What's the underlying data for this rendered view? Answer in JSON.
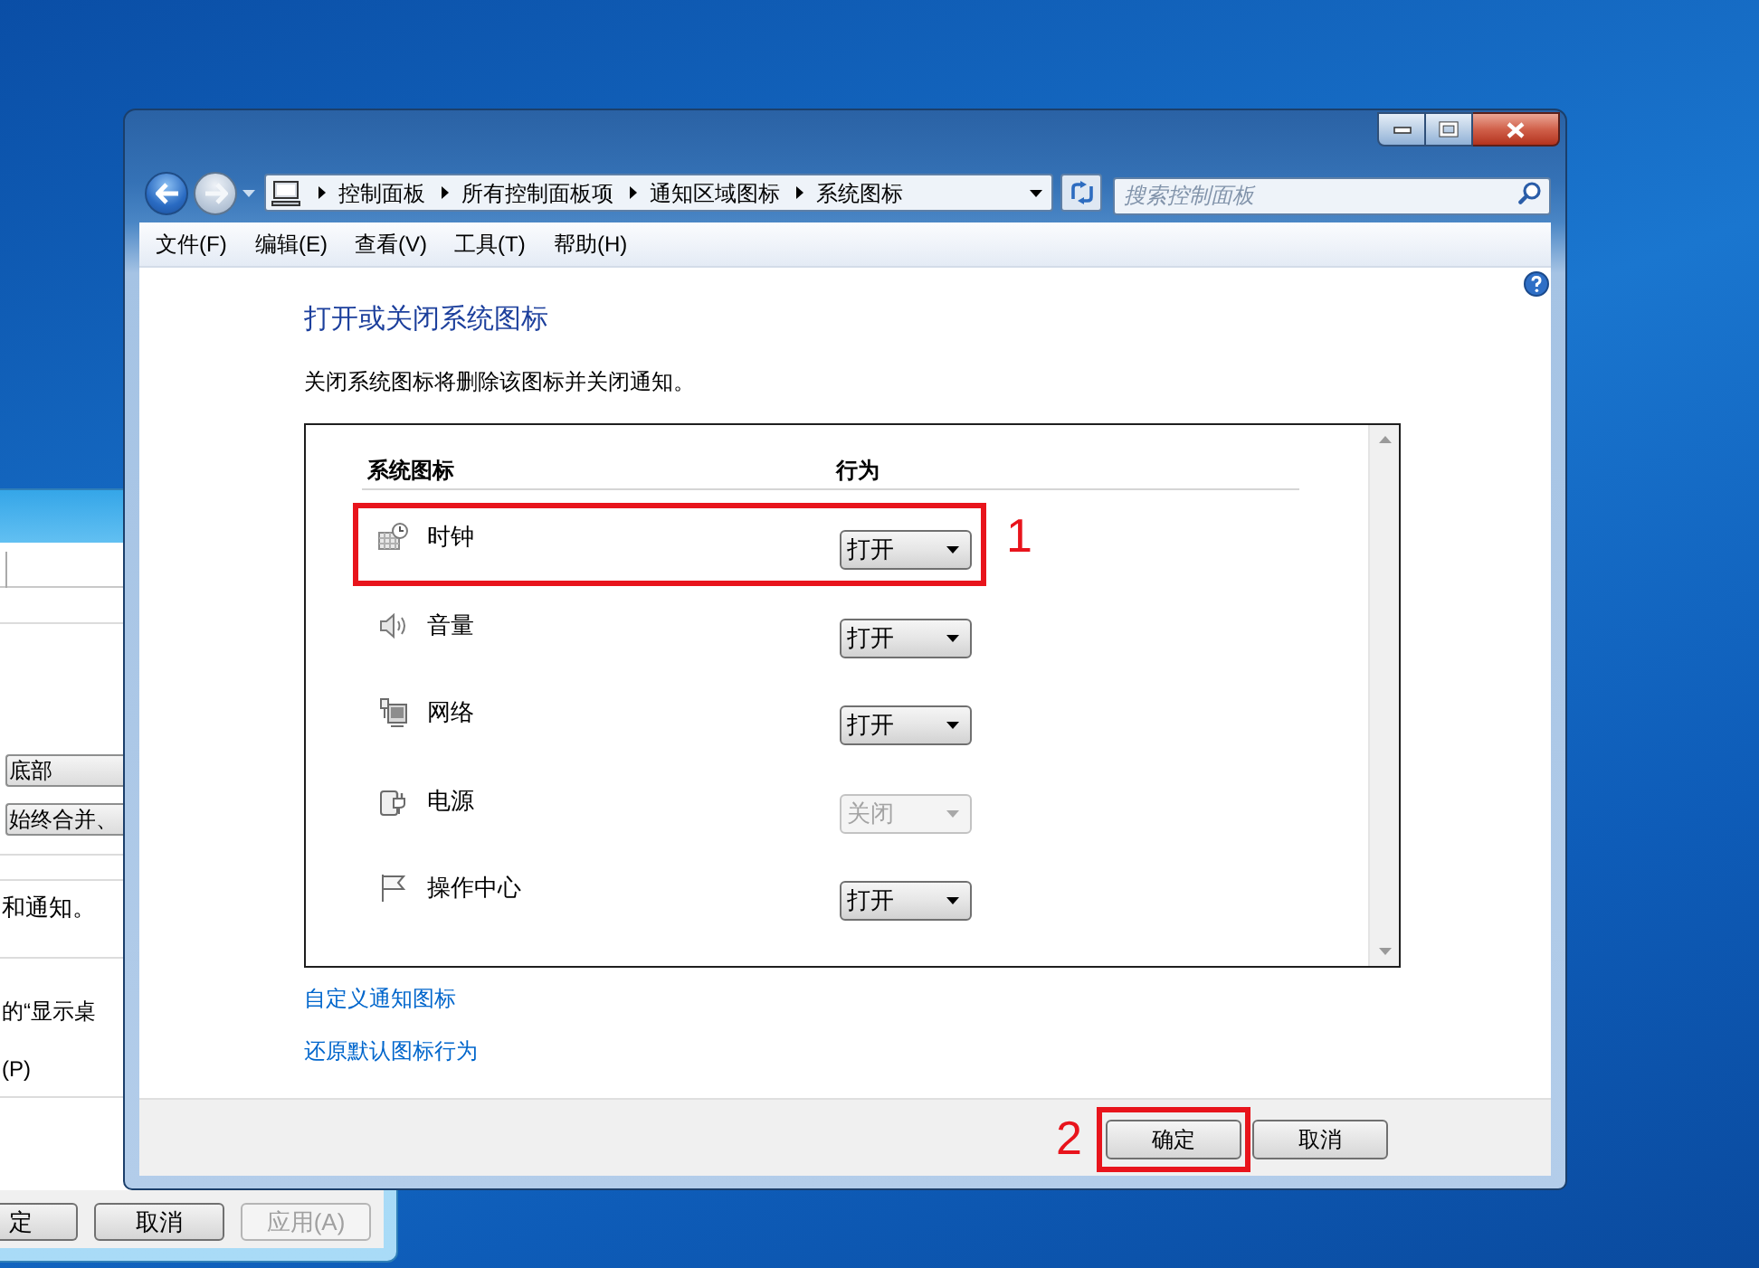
{
  "background_window": {
    "dropdowns": [
      {
        "value": "底部"
      },
      {
        "value": "始终合并、"
      }
    ],
    "texts": [
      "和通知。",
      "的“显示桌",
      "(P)"
    ],
    "buttons": [
      {
        "label": "定",
        "disabled": false
      },
      {
        "label": "取消",
        "disabled": false
      },
      {
        "label": "应用(A)",
        "disabled": true
      }
    ]
  },
  "window": {
    "address_bar": {
      "crumbs": [
        "控制面板",
        "所有控制面板项",
        "通知区域图标",
        "系统图标"
      ]
    },
    "search": {
      "placeholder": "搜索控制面板"
    },
    "menu": [
      "文件(F)",
      "编辑(E)",
      "查看(V)",
      "工具(T)",
      "帮助(H)"
    ],
    "heading": "打开或关闭系统图标",
    "description": "关闭系统图标将删除该图标并关闭通知。",
    "table": {
      "columns": [
        "系统图标",
        "行为"
      ],
      "rows": [
        {
          "name": "时钟",
          "behavior": "打开",
          "disabled": false,
          "callout": "1"
        },
        {
          "name": "音量",
          "behavior": "打开",
          "disabled": false
        },
        {
          "name": "网络",
          "behavior": "打开",
          "disabled": false
        },
        {
          "name": "电源",
          "behavior": "关闭",
          "disabled": true
        },
        {
          "name": "操作中心",
          "behavior": "打开",
          "disabled": false
        }
      ]
    },
    "links": [
      "自定义通知图标",
      "还原默认图标行为"
    ],
    "buttons": [
      {
        "label": "确定",
        "callout": "2"
      },
      {
        "label": "取消"
      }
    ]
  }
}
